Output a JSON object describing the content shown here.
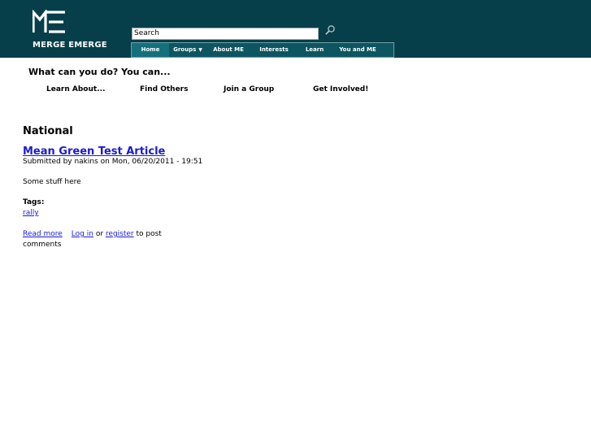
{
  "header": {
    "logo_text": "MERGE EMERGE",
    "logo_mark": "ME",
    "search": {
      "value": "Search",
      "placeholder": "Search"
    },
    "nav": [
      {
        "label": "Home"
      },
      {
        "label": "Groups"
      },
      {
        "label": "About ME"
      },
      {
        "label": "Interests"
      },
      {
        "label": "Learn"
      },
      {
        "label": "You and ME"
      }
    ]
  },
  "tagline": "What can you do? You can...",
  "actions": [
    {
      "label": "Learn About..."
    },
    {
      "label": "Find Others"
    },
    {
      "label": "Join a Group"
    },
    {
      "label": "Get Involved!"
    }
  ],
  "main": {
    "section_title": "National",
    "article": {
      "title": "Mean Green Test Article",
      "submitted": "Submitted by nakins on Mon, 06/20/2011 - 19:51",
      "body": "Some stuff here",
      "tags_label": "Tags:",
      "tags": [
        "rally"
      ],
      "links": {
        "read_more": "Read more",
        "log_in": "Log in",
        "or": "or",
        "register": "register",
        "to_post": "to post",
        "comments": "comments"
      }
    }
  },
  "colors": {
    "header_bg": "#063f49",
    "nav_bg": "#0d5560",
    "nav_active": "#15707c",
    "link": "#1a1ad6"
  }
}
